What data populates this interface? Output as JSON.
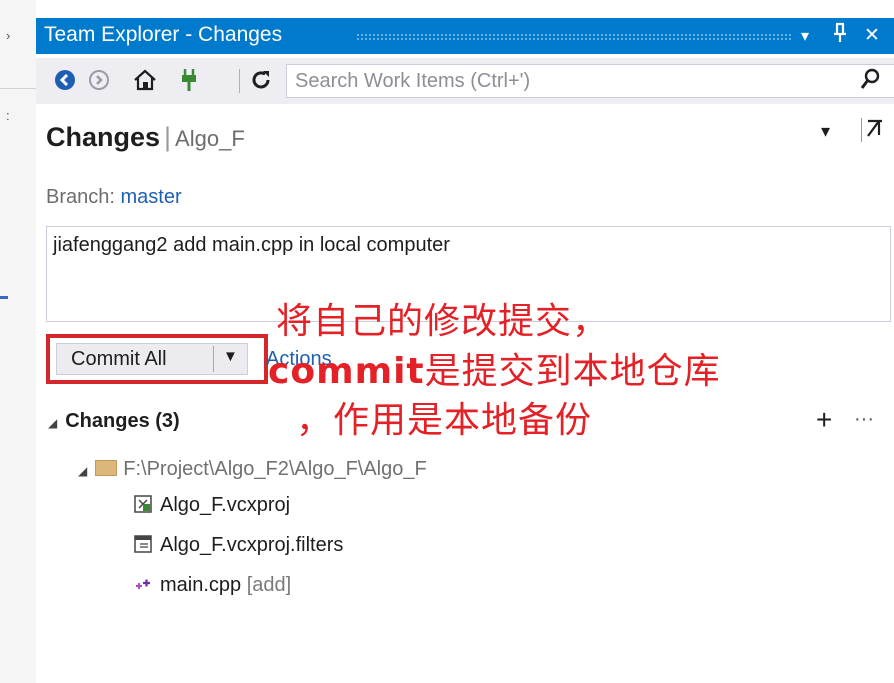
{
  "window": {
    "title": "Team Explorer - Changes",
    "dropdown_glyph": "▾",
    "pin_glyph": "ᵼ",
    "close_glyph": "✕"
  },
  "toolbar": {
    "icons": [
      "back-icon",
      "forward-icon",
      "home-icon",
      "connect-icon",
      "refresh-icon"
    ],
    "search_placeholder": "Search Work Items (Ctrl+')",
    "search_glyph": "⚲"
  },
  "header": {
    "title": "Changes",
    "separator": "|",
    "subtitle": "Algo_F"
  },
  "branch": {
    "label": "Branch:",
    "value": "master"
  },
  "commit": {
    "message": "jiafenggang2 add main.cpp in local computer",
    "button_label": "Commit All",
    "actions_label": "Actions"
  },
  "annotation": {
    "line1": "将自己的修改提交，",
    "line2_en": "commit",
    "line2_zh": "是提交到本地仓库",
    "line3": "，作用是本地备份",
    "color": "#e32126"
  },
  "changes": {
    "section_title": "Changes (3)",
    "add_glyph": "+",
    "more_glyph": "···",
    "folder_path": "F:\\Project\\Algo_F2\\Algo_F\\Algo_F",
    "files": [
      {
        "name": "Algo_F.vcxproj",
        "status": ""
      },
      {
        "name": "Algo_F.vcxproj.filters",
        "status": ""
      },
      {
        "name": "main.cpp",
        "status": "[add]"
      }
    ]
  },
  "colors": {
    "title_bar": "#007acc",
    "toolbar": "#eeeef2",
    "link": "#1e5fb4",
    "highlight_box": "#d3272a"
  }
}
